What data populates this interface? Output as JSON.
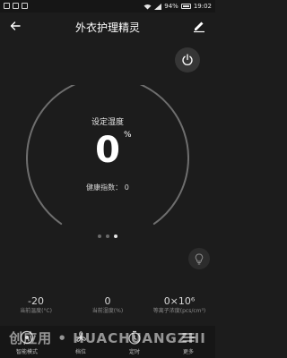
{
  "status_bar": {
    "battery": "94%",
    "time": "19:02"
  },
  "header": {
    "title": "外衣护理精灵"
  },
  "gauge": {
    "label": "设定湿度",
    "value": "0",
    "unit": "%",
    "health_label": "健康指数：",
    "health_value": "0",
    "pages": 3,
    "active_page": 2
  },
  "stats": [
    {
      "value": "-20",
      "label": "当前温度(°C)"
    },
    {
      "value": "0",
      "label": "当前湿度(%)"
    },
    {
      "value": "0×10⁶",
      "label": "等离子浓度(pcs/cm³)"
    }
  ],
  "nav": [
    {
      "label": "智能模式",
      "icon": "smart-mode-icon"
    },
    {
      "label": "档位",
      "icon": "fan-icon"
    },
    {
      "label": "定时",
      "icon": "timer-icon"
    },
    {
      "label": "更多",
      "icon": "more-icon"
    }
  ],
  "watermark": "创应用 • HUACHUANGZHI",
  "colors": {
    "background": "#1c1c1c",
    "gauge_track": "#6e6e6e",
    "text_primary": "#ffffff",
    "text_secondary": "#8c8c8c"
  }
}
